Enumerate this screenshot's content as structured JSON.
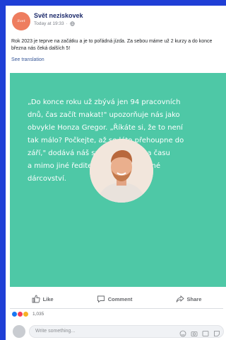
{
  "page": {
    "name": "Svět neziskovek",
    "avatar_text": "Svet",
    "time": "Today at 19:33",
    "separator": "·"
  },
  "post": {
    "text": "Rok 2023 je teprve na začátku a je to pořádná jízda. Za sebou máme už 2 kurzy a do konce března nás čeká dalších 5!",
    "see_translation": "See translation"
  },
  "image": {
    "quote_lines": [
      "„Do konce roku už zbývá jen 94 pracovních",
      "dnů, čas začít makat!\" upozorňuje nás jako",
      "obvykle Honza Gregor. „Říkáte si, že to není",
      "tak málo? Počkejte, až se léto přehoupne do",
      "září,\" dodává náš správce financí a času",
      "a mimo jiné ředitel koalice Za snadné",
      "dárcovství."
    ],
    "bg_color": "#4ec8a6"
  },
  "actions": {
    "like": "Like",
    "comment": "Comment",
    "share": "Share"
  },
  "reactions": {
    "count": "1,035",
    "types": [
      "like",
      "love",
      "wow"
    ]
  },
  "comment": {
    "placeholder": "Write something..."
  },
  "colors": {
    "background": "#1f3fd6",
    "accent": "#385898"
  }
}
